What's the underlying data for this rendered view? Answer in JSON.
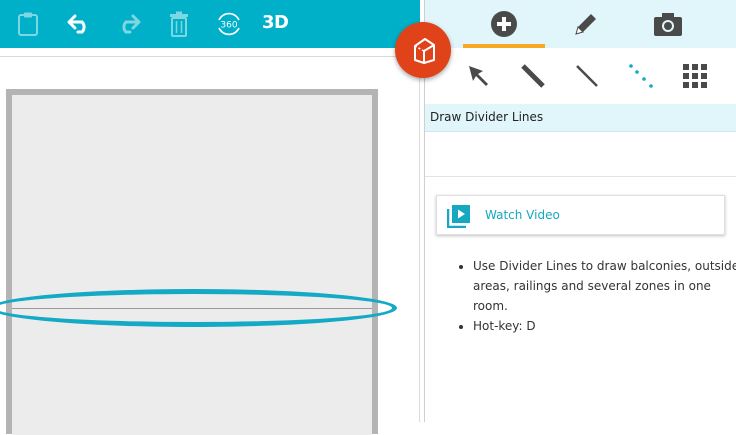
{
  "toolbar": {
    "buttons": [
      {
        "name": "clipboard-icon"
      },
      {
        "name": "undo-icon"
      },
      {
        "name": "redo-icon"
      },
      {
        "name": "trash-icon"
      },
      {
        "name": "360-view-icon",
        "label": "360"
      },
      {
        "name": "3d-view",
        "label": "3D"
      }
    ]
  },
  "panel": {
    "tabs": [
      {
        "name": "add-icon",
        "active": true
      },
      {
        "name": "pencil-icon",
        "active": false
      },
      {
        "name": "camera-icon",
        "active": false
      }
    ],
    "tools": [
      {
        "name": "select-arrow-icon"
      },
      {
        "name": "wall-line-icon"
      },
      {
        "name": "divider-line-icon"
      },
      {
        "name": "dotted-line-icon"
      },
      {
        "name": "grid-icon"
      }
    ],
    "title": "Draw Divider Lines",
    "video_label": "Watch Video",
    "help": [
      "Use Divider Lines to draw balconies, outside areas, railings and several zones in one room.",
      "Hot-key: D"
    ]
  },
  "colors": {
    "accent": "#00b0c8",
    "tab_bg": "#e1f6fa",
    "active_tab": "#f7a825",
    "badge": "#e0431a",
    "highlight": "#14a9c5",
    "link": "#16a8c1"
  }
}
